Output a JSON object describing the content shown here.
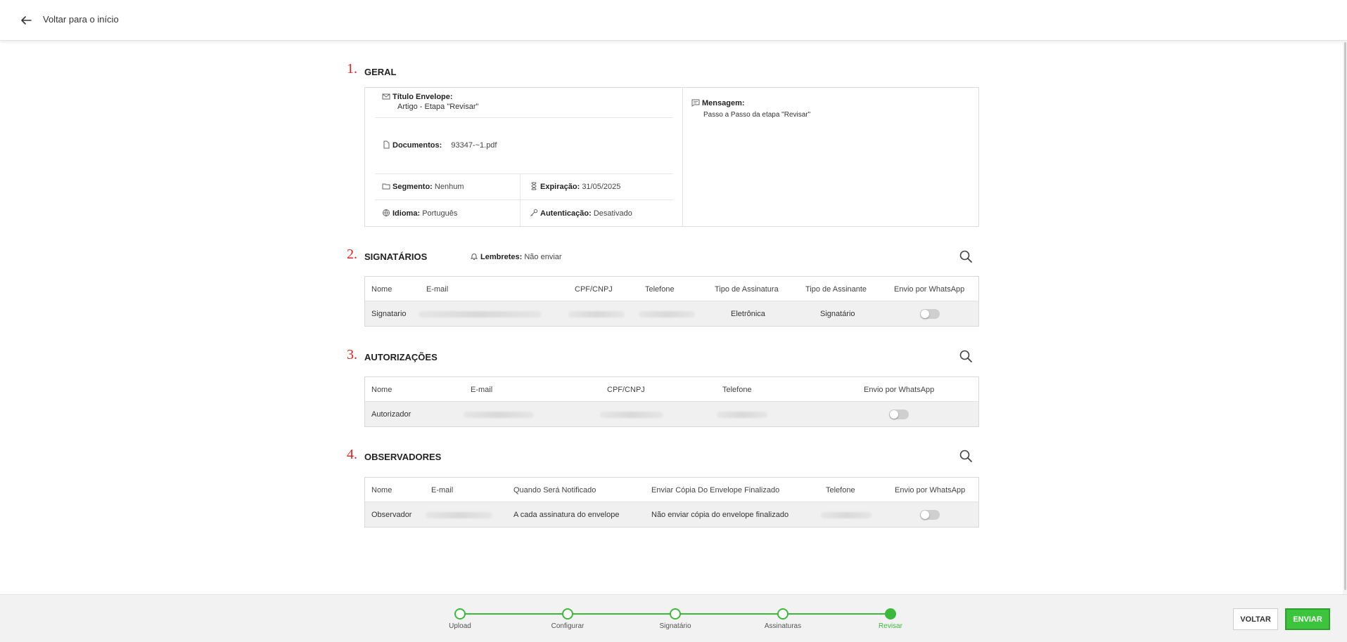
{
  "header": {
    "back_label": "Voltar para o início"
  },
  "sections": {
    "geral": {
      "num": "1.",
      "title": "GERAL"
    },
    "signatarios": {
      "num": "2.",
      "title": "SIGNATÁRIOS"
    },
    "autorizacoes": {
      "num": "3.",
      "title": "AUTORIZAÇÕES"
    },
    "observadores": {
      "num": "4.",
      "title": "OBSERVADORES"
    }
  },
  "geral": {
    "titulo_label": "Título Envelope:",
    "titulo_value": "Artigo - Etapa \"Revisar\"",
    "documentos_label": "Documentos:",
    "documentos_value": "93347-~1.pdf",
    "segmento_label": "Segmento:",
    "segmento_value": "Nenhum",
    "expiracao_label": "Expiração:",
    "expiracao_value": "31/05/2025",
    "idioma_label": "Idioma:",
    "idioma_value": "Português",
    "autenticacao_label": "Autenticação:",
    "autenticacao_value": "Desativado",
    "mensagem_label": "Mensagem:",
    "mensagem_value": "Passo a Passo da etapa \"Revisar\""
  },
  "lembretes": {
    "label": "Lembretes:",
    "value": "Não enviar"
  },
  "signatarios_table": {
    "headers": [
      "Nome",
      "E-mail",
      "CPF/CNPJ",
      "Telefone",
      "Tipo de Assinatura",
      "Tipo de Assinante",
      "Envio por WhatsApp"
    ],
    "row": {
      "nome": "Signatario",
      "tipo_assinatura": "Eletrônica",
      "tipo_assinante": "Signatário",
      "whatsapp": false
    }
  },
  "autorizacoes_table": {
    "headers": [
      "Nome",
      "E-mail",
      "CPF/CNPJ",
      "Telefone",
      "Envio por WhatsApp"
    ],
    "row": {
      "nome": "Autorizador",
      "whatsapp": false
    }
  },
  "observadores_table": {
    "headers": [
      "Nome",
      "E-mail",
      "Quando Será Notificado",
      "Enviar Cópia Do Envelope Finalizado",
      "Telefone",
      "Envio por WhatsApp"
    ],
    "row": {
      "nome": "Observador",
      "quando": "A cada assinatura do envelope",
      "copia": "Não enviar cópia do envelope finalizado",
      "whatsapp": false
    }
  },
  "stepper": {
    "steps": [
      "Upload",
      "Configurar",
      "Signatário",
      "Assinaturas",
      "Revisar"
    ],
    "active_index": 4
  },
  "footer": {
    "back_button": "VOLTAR",
    "send_button": "ENVIAR"
  },
  "colors": {
    "accent": "#3cb93c",
    "section_number": "#e02020"
  }
}
